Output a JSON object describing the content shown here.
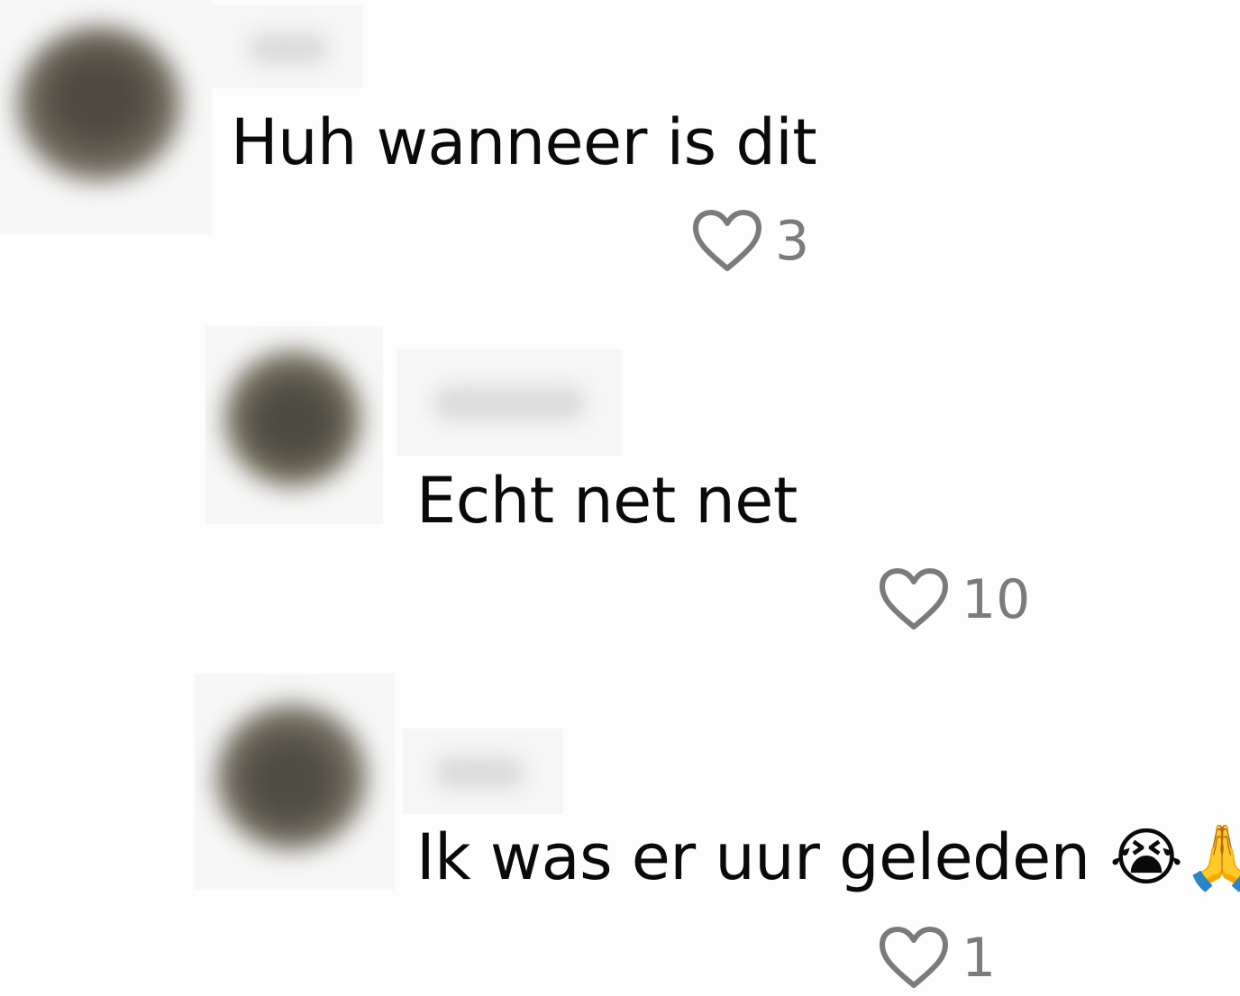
{
  "comments": [
    {
      "text": "Huh wanneer is dit",
      "likes": "3",
      "like_icon": "heart-outline-icon"
    },
    {
      "text": "Echt net net",
      "likes": "10",
      "like_icon": "heart-outline-icon"
    },
    {
      "text": "Ik was er uur geleden 😭🙏",
      "likes": "1",
      "like_icon": "heart-outline-icon"
    }
  ],
  "colors": {
    "background": "#fdfdfd",
    "text": "#0a0a0a",
    "like_icon": "#7b7b7b"
  }
}
